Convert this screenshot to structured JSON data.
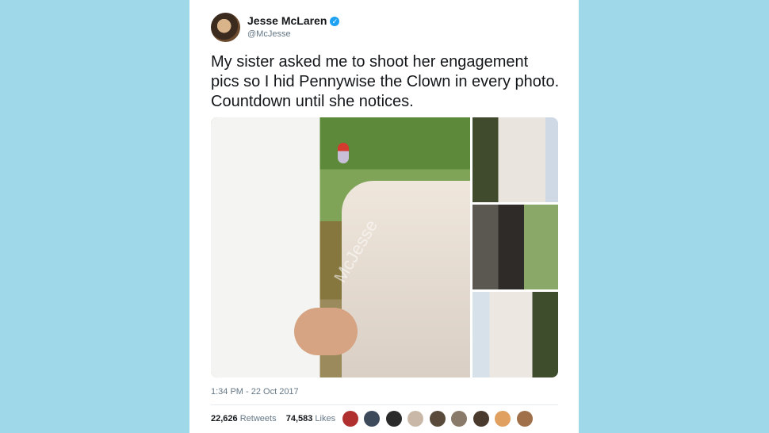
{
  "user": {
    "name": "Jesse McLaren",
    "handle": "@McJesse",
    "verified_glyph": "✓"
  },
  "tweet": {
    "text": "My sister asked me to shoot her engagement pics so I hid Pennywise the Clown in every photo. Countdown until she notices.",
    "watermark": "McJesse",
    "timestamp": "1:34 PM - 22 Oct 2017"
  },
  "stats": {
    "retweets_count": "22,626",
    "retweets_label": "Retweets",
    "likes_count": "74,583",
    "likes_label": "Likes"
  },
  "colors": {
    "background": "#9fd8e8",
    "verified": "#1da1f2"
  }
}
